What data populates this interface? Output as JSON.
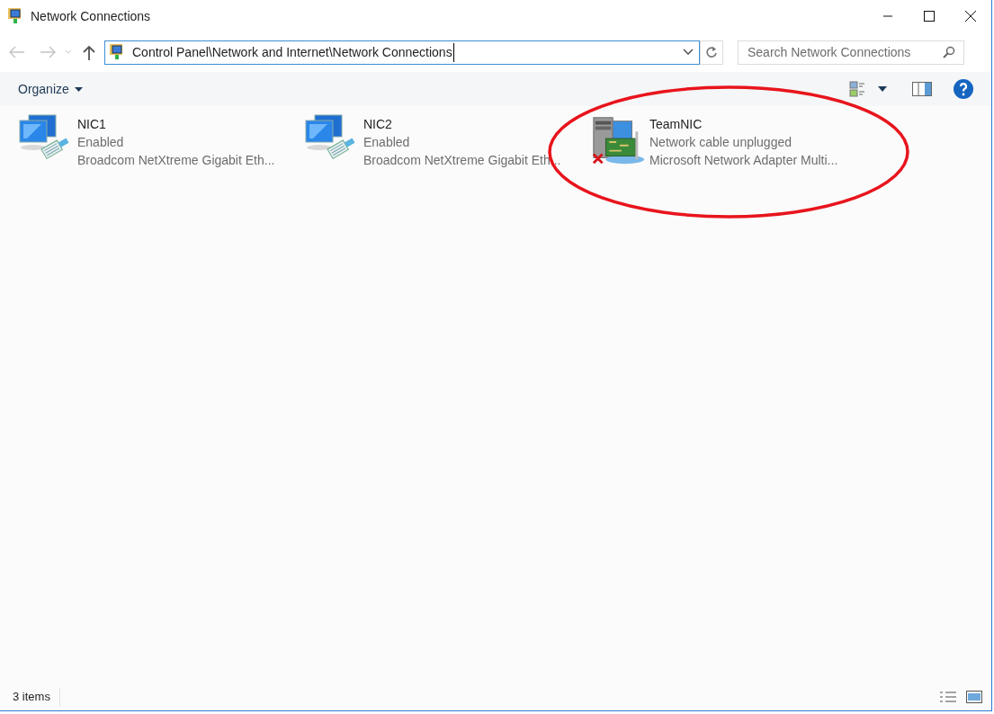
{
  "window": {
    "title": "Network Connections"
  },
  "address_bar": {
    "path": "Control Panel\\Network and Internet\\Network Connections"
  },
  "search": {
    "placeholder": "Search Network Connections"
  },
  "command_bar": {
    "organize": "Organize"
  },
  "connections": [
    {
      "kind": "connected",
      "name": "NIC1",
      "status": "Enabled",
      "adapter": "Broadcom NetXtreme Gigabit Eth..."
    },
    {
      "kind": "connected",
      "name": "NIC2",
      "status": "Enabled",
      "adapter": "Broadcom NetXtreme Gigabit Eth..."
    },
    {
      "kind": "unplugged",
      "name": "TeamNIC",
      "status": "Network cable unplugged",
      "adapter": "Microsoft Network Adapter Multi..."
    }
  ],
  "status_bar": {
    "item_count": "3 items"
  }
}
